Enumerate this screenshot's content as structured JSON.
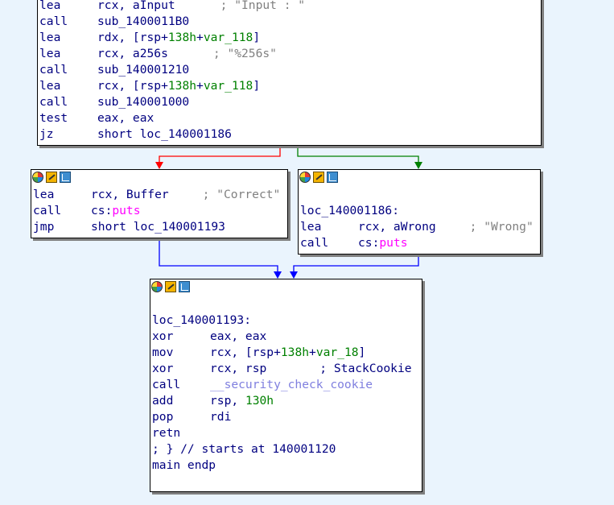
{
  "theme": {
    "background": "#eaf4fd",
    "edge_false": "#ff0000",
    "edge_true": "#008000",
    "edge_jump": "#0000ff"
  },
  "header_icons": [
    "color-picker-icon",
    "rename-edit-icon",
    "graph-overview-icon"
  ],
  "block_top": {
    "lines": [
      {
        "mnem": "lea",
        "ops": "rcx, aInput",
        "comment": "; \"Input : \""
      },
      {
        "mnem": "call",
        "ops": "sub_1400011B0"
      },
      {
        "mnem": "lea",
        "ops_pre": "rdx, [rsp+",
        "ops_num": "138h",
        "ops_mid": "+",
        "ops_var": "var_118",
        "ops_post": "]"
      },
      {
        "mnem": "lea",
        "ops": "rcx, a256s",
        "comment": "; \"%256s\""
      },
      {
        "mnem": "call",
        "ops": "sub_140001210"
      },
      {
        "mnem": "lea",
        "ops_pre": "rcx, [rsp+",
        "ops_num": "138h",
        "ops_mid": "+",
        "ops_var": "var_118",
        "ops_post": "]"
      },
      {
        "mnem": "call",
        "ops": "sub_140001000"
      },
      {
        "mnem": "test",
        "ops": "eax, eax"
      },
      {
        "mnem": "jz",
        "ops": "short loc_140001186"
      }
    ]
  },
  "block_left": {
    "lines": [
      {
        "mnem": "lea",
        "ops": "rcx, Buffer",
        "comment": "; \"Correct\""
      },
      {
        "mnem": "call",
        "ops_pre": "cs:",
        "ops_fn": "puts"
      },
      {
        "mnem": "jmp",
        "ops": "short loc_140001193"
      }
    ]
  },
  "block_right": {
    "label": "loc_140001186:",
    "lines": [
      {
        "mnem": "lea",
        "ops": "rcx, aWrong",
        "comment": "; \"Wrong\""
      },
      {
        "mnem": "call",
        "ops_pre": "cs:",
        "ops_fn": "puts"
      }
    ]
  },
  "block_bottom": {
    "label": "loc_140001193:",
    "lines": [
      {
        "mnem": "xor",
        "ops": "eax, eax"
      },
      {
        "mnem": "mov",
        "ops_pre": "rcx, [rsp+",
        "ops_num": "138h",
        "ops_mid": "+",
        "ops_var": "var_18",
        "ops_post": "]"
      },
      {
        "mnem": "xor",
        "ops": "rcx, rsp",
        "comment": "; StackCookie"
      },
      {
        "mnem": "call",
        "ops_ext": "__security_check_cookie"
      },
      {
        "mnem": "add",
        "ops_pre": "rsp, ",
        "ops_num": "130h"
      },
      {
        "mnem": "pop",
        "ops": "rdi"
      },
      {
        "mnem": "retn"
      }
    ],
    "footer": [
      "; } // starts at 140001120",
      "main endp"
    ]
  }
}
